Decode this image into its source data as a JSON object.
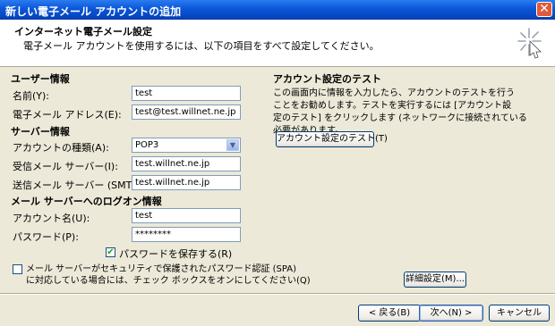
{
  "window": {
    "title": "新しい電子メール アカウントの追加",
    "close_glyph": "✕"
  },
  "header": {
    "title": "インターネット電子メール設定",
    "subtitle": "電子メール アカウントを使用するには、以下の項目をすべて設定してください。",
    "icon": "sparkle-icon"
  },
  "user_info": {
    "section": "ユーザー情報",
    "name_label": "名前(Y):",
    "name_value": "test",
    "email_label": "電子メール アドレス(E):",
    "email_value": "test@test.willnet.ne.jp"
  },
  "server_info": {
    "section": "サーバー情報",
    "account_type_label": "アカウントの種類(A):",
    "account_type_value": "POP3",
    "incoming_label": "受信メール サーバー(I):",
    "incoming_value": "test.willnet.ne.jp",
    "outgoing_label": "送信メール サーバー (SMTP)(O):",
    "outgoing_value": "test.willnet.ne.jp"
  },
  "logon_info": {
    "section": "メール サーバーへのログオン情報",
    "account_name_label": "アカウント名(U):",
    "account_name_value": "test",
    "password_label": "パスワード(P):",
    "password_value": "********",
    "save_password_label": "パスワードを保存する(R)",
    "save_password_checked": true,
    "spa_line1": "メール サーバーがセキュリティで保護されたパスワード認証 (SPA)",
    "spa_line2": "に対応している場合には、チェック ボックスをオンにしてください(Q)",
    "spa_checked": false
  },
  "test_section": {
    "title": "アカウント設定のテスト",
    "line1": "この画面内に情報を入力したら、アカウントのテストを行う",
    "line2": "ことをお勧めします。テストを実行するには [アカウント設",
    "line3": "定のテスト] をクリックします (ネットワークに接続されている",
    "line4": "必要があります。",
    "test_button": "アカウント設定のテスト(T)"
  },
  "buttons": {
    "advanced": "詳細設定(M)...",
    "back": "< 戻る(B)",
    "next": "次へ(N) >",
    "cancel": "キャンセル"
  }
}
